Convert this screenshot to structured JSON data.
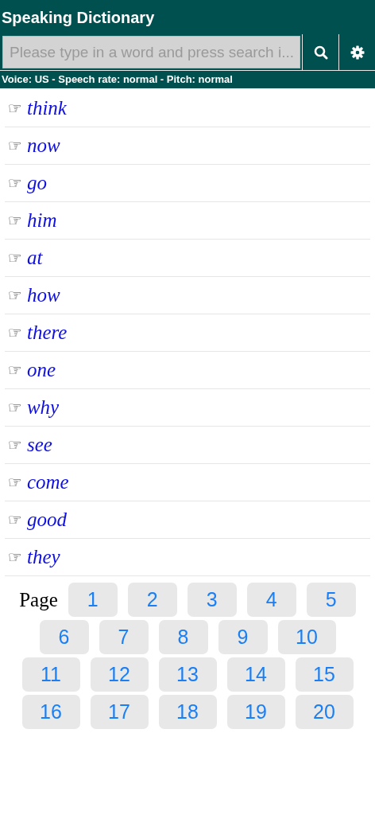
{
  "header": {
    "title": "Speaking Dictionary"
  },
  "search": {
    "placeholder": "Please type in a word and press search i..."
  },
  "status": "Voice: US - Speech rate: normal - Pitch: normal",
  "words": [
    {
      "icon": "☞",
      "word": "think"
    },
    {
      "icon": "☞",
      "word": "now"
    },
    {
      "icon": "☞",
      "word": "go"
    },
    {
      "icon": "☞",
      "word": "him"
    },
    {
      "icon": "☞",
      "word": "at"
    },
    {
      "icon": "☞",
      "word": "how"
    },
    {
      "icon": "☞",
      "word": "there"
    },
    {
      "icon": "☞",
      "word": "one"
    },
    {
      "icon": "☞",
      "word": "why"
    },
    {
      "icon": "☞",
      "word": "see"
    },
    {
      "icon": "☞",
      "word": "come"
    },
    {
      "icon": "☞",
      "word": "good"
    },
    {
      "icon": "☞",
      "word": "they"
    }
  ],
  "pagination": {
    "label": "Page",
    "pages": [
      "1",
      "2",
      "3",
      "4",
      "5",
      "6",
      "7",
      "8",
      "9",
      "10",
      "11",
      "12",
      "13",
      "14",
      "15",
      "16",
      "17",
      "18",
      "19",
      "20"
    ]
  }
}
